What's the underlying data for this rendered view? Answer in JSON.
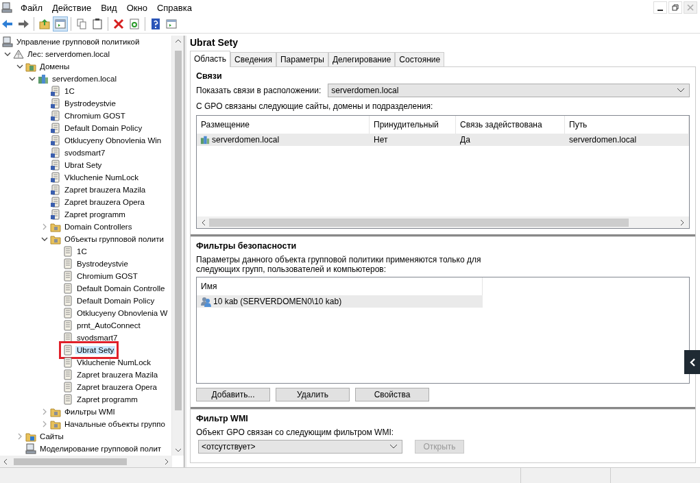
{
  "menu": [
    "Файл",
    "Действие",
    "Вид",
    "Окно",
    "Справка"
  ],
  "toolbar": [
    {
      "kind": "back",
      "pressed": false
    },
    {
      "kind": "forward",
      "pressed": false
    },
    {
      "kind": "separator"
    },
    {
      "kind": "up",
      "pressed": false
    },
    {
      "kind": "tree-toggle",
      "pressed": true
    },
    {
      "kind": "separator"
    },
    {
      "kind": "copy",
      "pressed": false
    },
    {
      "kind": "paste",
      "pressed": false
    },
    {
      "kind": "separator"
    },
    {
      "kind": "delete",
      "pressed": false
    },
    {
      "kind": "refresh",
      "pressed": false
    },
    {
      "kind": "separator"
    },
    {
      "kind": "help",
      "pressed": false
    },
    {
      "kind": "panel",
      "pressed": false
    }
  ],
  "tree": {
    "items": [
      {
        "label": "Управление групповой политикой",
        "kind": "console",
        "selected": false,
        "children": [
          {
            "label": "Лес: serverdomen.local",
            "kind": "forest",
            "expanded": true,
            "selected": false,
            "children": [
              {
                "label": "Домены",
                "kind": "domains",
                "expanded": true,
                "selected": false,
                "children": [
                  {
                    "label": "serverdomen.local",
                    "kind": "domain",
                    "expanded": true,
                    "selected": false,
                    "children": [
                      {
                        "label": "1C",
                        "kind": "gpo-link",
                        "selected": false
                      },
                      {
                        "label": "Bystrodeystvie",
                        "kind": "gpo-link",
                        "selected": false
                      },
                      {
                        "label": "Chromium GOST",
                        "kind": "gpo-link",
                        "selected": false
                      },
                      {
                        "label": "Default Domain Policy",
                        "kind": "gpo-link",
                        "selected": false
                      },
                      {
                        "label": "Otklucyeny Obnovlenia Win",
                        "kind": "gpo-link",
                        "selected": false
                      },
                      {
                        "label": "svodsmart7",
                        "kind": "gpo-link",
                        "selected": false
                      },
                      {
                        "label": "Ubrat Sety",
                        "kind": "gpo-link",
                        "selected": false
                      },
                      {
                        "label": "Vkluchenie NumLock",
                        "kind": "gpo-link",
                        "selected": false
                      },
                      {
                        "label": "Zapret brauzera Mazila",
                        "kind": "gpo-link",
                        "selected": false
                      },
                      {
                        "label": "Zapret brauzera Opera",
                        "kind": "gpo-link",
                        "selected": false
                      },
                      {
                        "label": "Zapret programm",
                        "kind": "gpo-link",
                        "selected": false
                      },
                      {
                        "label": "Domain Controllers",
                        "kind": "ou",
                        "expanded": false,
                        "selected": false
                      },
                      {
                        "label": "Объекты групповой полити",
                        "kind": "gpo-folder",
                        "expanded": true,
                        "selected": false,
                        "children": [
                          {
                            "label": "1C",
                            "kind": "gpo",
                            "selected": false
                          },
                          {
                            "label": "Bystrodeystvie",
                            "kind": "gpo",
                            "selected": false
                          },
                          {
                            "label": "Chromium GOST",
                            "kind": "gpo",
                            "selected": false
                          },
                          {
                            "label": "Default Domain Controlle",
                            "kind": "gpo",
                            "selected": false
                          },
                          {
                            "label": "Default Domain Policy",
                            "kind": "gpo",
                            "selected": false
                          },
                          {
                            "label": "Otklucyeny Obnovlenia W",
                            "kind": "gpo",
                            "selected": false
                          },
                          {
                            "label": "prnt_AutoConnect",
                            "kind": "gpo",
                            "selected": false
                          },
                          {
                            "label": "svodsmart7",
                            "kind": "gpo",
                            "selected": false
                          },
                          {
                            "label": "Ubrat Sety",
                            "kind": "gpo",
                            "selected": true,
                            "marked": true
                          },
                          {
                            "label": "Vkluchenie NumLock",
                            "kind": "gpo",
                            "selected": false
                          },
                          {
                            "label": "Zapret brauzera Mazila",
                            "kind": "gpo",
                            "selected": false
                          },
                          {
                            "label": "Zapret brauzera Opera",
                            "kind": "gpo",
                            "selected": false
                          },
                          {
                            "label": "Zapret programm",
                            "kind": "gpo",
                            "selected": false
                          }
                        ]
                      },
                      {
                        "label": "Фильтры WMI",
                        "kind": "wmi",
                        "expanded": false,
                        "selected": false
                      },
                      {
                        "label": "Начальные объекты группо",
                        "kind": "starter",
                        "expanded": false,
                        "selected": false
                      }
                    ]
                  }
                ]
              },
              {
                "label": "Сайты",
                "kind": "sites",
                "expanded": false,
                "selected": false
              },
              {
                "label": "Моделирование групповой полит",
                "kind": "modeling",
                "selected": false
              }
            ]
          }
        ]
      }
    ]
  },
  "details": {
    "title": "Ubrat Sety",
    "tabs": [
      {
        "label": "Область",
        "selected": true
      },
      {
        "label": "Сведения",
        "selected": false
      },
      {
        "label": "Параметры",
        "selected": false
      },
      {
        "label": "Делегирование",
        "selected": false
      },
      {
        "label": "Состояние",
        "selected": false
      }
    ],
    "links": {
      "heading": "Связи",
      "location_label": "Показать связи в расположении:",
      "location_value": "serverdomen.local",
      "description": "С GPO связаны следующие сайты, домены и подразделения:",
      "table": {
        "columns": [
          "Размещение",
          "Принудительный",
          "Связь задействована",
          "Путь"
        ],
        "rows": [
          {
            "cells": [
              "serverdomen.local",
              "Нет",
              "Да",
              "serverdomen.local"
            ],
            "selected": true
          }
        ]
      }
    },
    "security": {
      "heading": "Фильтры безопасности",
      "description": "Параметры данного объекта групповой политики применяются только для следующих групп, пользователей и компьютеров:",
      "list": {
        "columns": [
          "Имя"
        ],
        "rows": [
          {
            "name": "10 kab (SERVERDOMEN0\\10 kab)",
            "selected": true
          }
        ]
      },
      "buttons": [
        {
          "label": "Добавить...",
          "disabled": false
        },
        {
          "label": "Удалить",
          "disabled": false
        },
        {
          "label": "Свойства",
          "disabled": false
        }
      ]
    },
    "wmi": {
      "heading": "Фильтр WMI",
      "label": "Объект GPO связан со следующим фильтром WMI:",
      "value": "<отсутствует>",
      "button": {
        "label": "Открыть",
        "disabled": true
      }
    }
  }
}
